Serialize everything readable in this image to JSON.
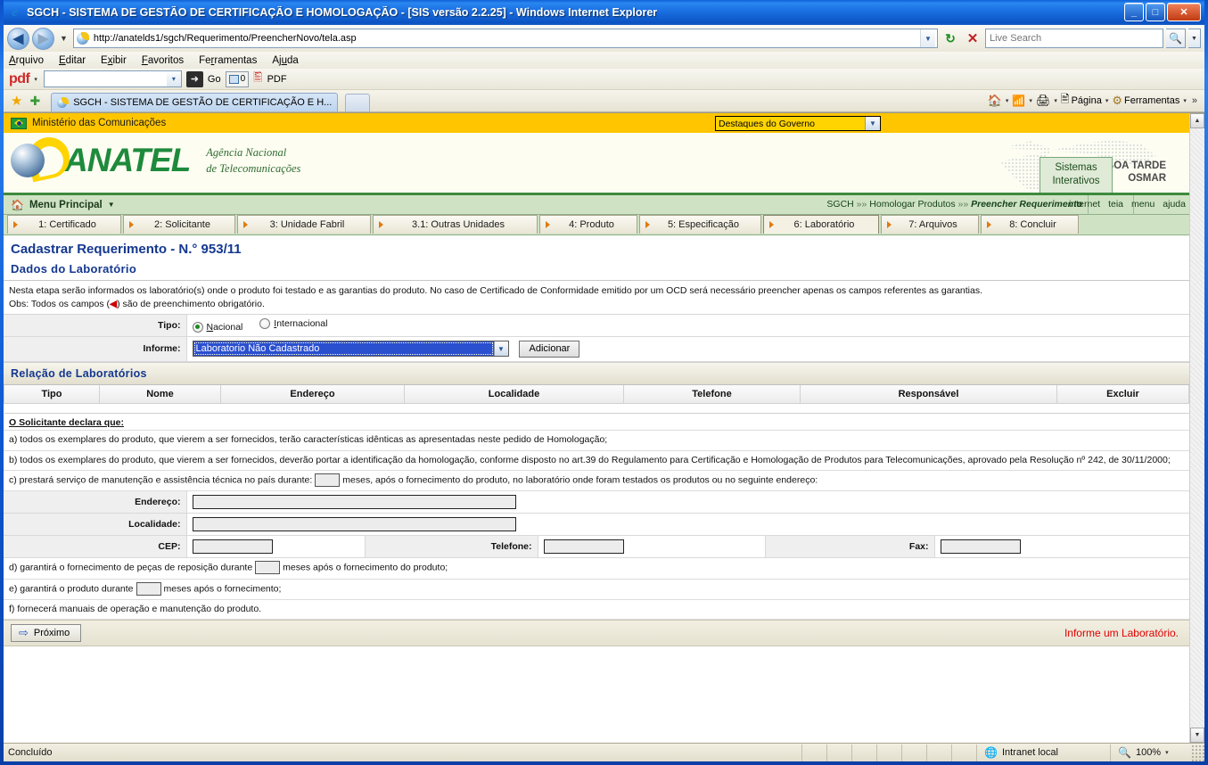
{
  "window": {
    "title": "SGCH - SISTEMA DE GESTÃO DE CERTIFICAÇÃO E HOMOLOGAÇÃO - [SIS versão 2.2.25] - Windows Internet Explorer",
    "minimize": "_",
    "maximize": "□",
    "close": "✕"
  },
  "browser": {
    "back": "◀",
    "forward": "▶",
    "history_caret": "▼",
    "url": "http://anatelds1/sgch/Requerimento/PreencherNovo/tela.asp",
    "url_caret": "▼",
    "refresh": "↻",
    "stop": "✕",
    "search_placeholder": "Live Search",
    "search_icon": "🔍",
    "search_caret": "▼",
    "menu": [
      "Arquivo",
      "Editar",
      "Exibir",
      "Favoritos",
      "Ferramentas",
      "Ajuda"
    ],
    "pdf_toolbar": {
      "logo": "pdf",
      "caret": "▾",
      "combo_value": "",
      "go_label": "Go",
      "go_icon": "➜",
      "window_count": "0",
      "pdf_label": "PDF"
    },
    "tab_title": "SGCH - SISTEMA DE GESTÃO DE CERTIFICAÇÃO E H...",
    "fav_star": "★",
    "fav_add": "✚",
    "toolbar_right": [
      {
        "name": "home",
        "icon": "🏠",
        "label": "",
        "caret": "▾"
      },
      {
        "name": "feeds",
        "icon": "📡",
        "label": "",
        "caret": "▾"
      },
      {
        "name": "print",
        "icon": "🖨",
        "label": "",
        "caret": "▾"
      },
      {
        "name": "page",
        "icon": "📄",
        "label": "Página",
        "caret": "▾"
      },
      {
        "name": "tools",
        "icon": "⚙",
        "label": "Ferramentas",
        "caret": "▾"
      }
    ],
    "overflow": "»"
  },
  "gov": {
    "ministry": "Ministério das Comunicações",
    "highlight_select": "Destaques do Governo",
    "select_caret": "▼"
  },
  "anatel": {
    "logo_text": "ANATEL",
    "subtitle_line1": "Agência Nacional",
    "subtitle_line2": "de Telecomunicações",
    "greeting_line1": "BOA TARDE",
    "greeting_line2": "OSMAR",
    "sis_tab_line1": "Sistemas",
    "sis_tab_line2": "Interativos"
  },
  "nav": {
    "menu_principal": "Menu Principal",
    "menu_icon": "🏠",
    "menu_caret": "▼",
    "breadcrumb_root": "SGCH",
    "breadcrumb_sep": "»»",
    "breadcrumb_mid": "Homologar Produtos",
    "breadcrumb_current": "Preencher Requerimento",
    "links": [
      "internet",
      "teia",
      "menu",
      "ajuda"
    ]
  },
  "steps": [
    {
      "label": "1: Certificado",
      "active": false
    },
    {
      "label": "2: Solicitante",
      "active": false
    },
    {
      "label": "3: Unidade Fabril",
      "active": false
    },
    {
      "label": "3.1: Outras Unidades",
      "active": false
    },
    {
      "label": "4: Produto",
      "active": false
    },
    {
      "label": "5: Especificação",
      "active": false
    },
    {
      "label": "6: Laboratório",
      "active": true
    },
    {
      "label": "7: Arquivos",
      "active": false
    },
    {
      "label": "8: Concluir",
      "active": false
    }
  ],
  "main": {
    "page_title": "Cadastrar Requerimento - N.° 953/11",
    "section_title": "Dados do Laboratório",
    "info_line1": "Nesta etapa serão informados os laboratório(s) onde o produto foi testado e as garantias do produto. No caso de Certificado de Conformidade emitido por um OCD será necessário preencher apenas os campos referentes as garantias.",
    "info_line2_pre": "Obs: Todos os campos (",
    "info_line2_mark": "◀",
    "info_line2_post": ") são de preenchimento obrigatório.",
    "tipo_label": "Tipo:",
    "tipo_options": [
      {
        "label": "Nacional",
        "underline": "N",
        "checked": true
      },
      {
        "label": "Internacional",
        "underline": "I",
        "checked": false
      }
    ],
    "informe_label": "Informe:",
    "informe_value": "Laboratorio Não Cadastrado",
    "informe_caret": "▼",
    "add_button": "Adicionar",
    "relacao_title": "Relação de Laboratórios",
    "table_headers": [
      "Tipo",
      "Nome",
      "Endereço",
      "Localidade",
      "Telefone",
      "Responsável",
      "Excluir"
    ],
    "table_rows": [],
    "decl_title": "O Solicitante declara que:",
    "decl_a": "a) todos os exemplares do produto, que vierem a ser fornecidos, terão características idênticas as apresentadas neste pedido de Homologação;",
    "decl_b": "b) todos os exemplares do produto, que vierem a ser fornecidos, deverão portar a identificação da homologação, conforme disposto no art.39 do Regulamento para Certificação e Homologação de Produtos para Telecomunicações, aprovado pela Resolução nº 242, de 30/11/2000;",
    "decl_c_pre": "c) prestará serviço de manutenção e assistência técnica no país durante:",
    "decl_c_value": "",
    "decl_c_post": "meses, após o fornecimento do produto, no laboratório onde foram testados os produtos ou no seguinte endereço:",
    "endereco_label": "Endereço:",
    "endereco_value": "",
    "localidade_label": "Localidade:",
    "localidade_value": "",
    "cep_label": "CEP:",
    "cep_value": "",
    "telefone_label": "Telefone:",
    "telefone_value": "",
    "fax_label": "Fax:",
    "fax_value": "",
    "decl_d_pre": "d) garantirá o fornecimento de peças de reposição durante",
    "decl_d_value": "",
    "decl_d_post": "meses após o fornecimento do produto;",
    "decl_e_pre": "e) garantirá o produto durante",
    "decl_e_value": "",
    "decl_e_post": "meses após o fornecimento;",
    "decl_f": "f) fornecerá manuais de operação e manutenção do produto.",
    "next_button": "Próximo",
    "next_icon": "⇨",
    "error_message": "Informe um Laboratório."
  },
  "statusbar": {
    "status_text": "Concluído",
    "zone_label": "Intranet local",
    "zone_icon": "🌐",
    "zoom_label": "100%",
    "zoom_icon": "🔍",
    "zoom_caret": "▾"
  },
  "colors": {
    "gov_yellow": "#ffc600",
    "anatel_green": "#1e8a3c",
    "title_blue": "#14388f",
    "error_red": "#e00000",
    "select_highlight": "#2a4fcf"
  }
}
